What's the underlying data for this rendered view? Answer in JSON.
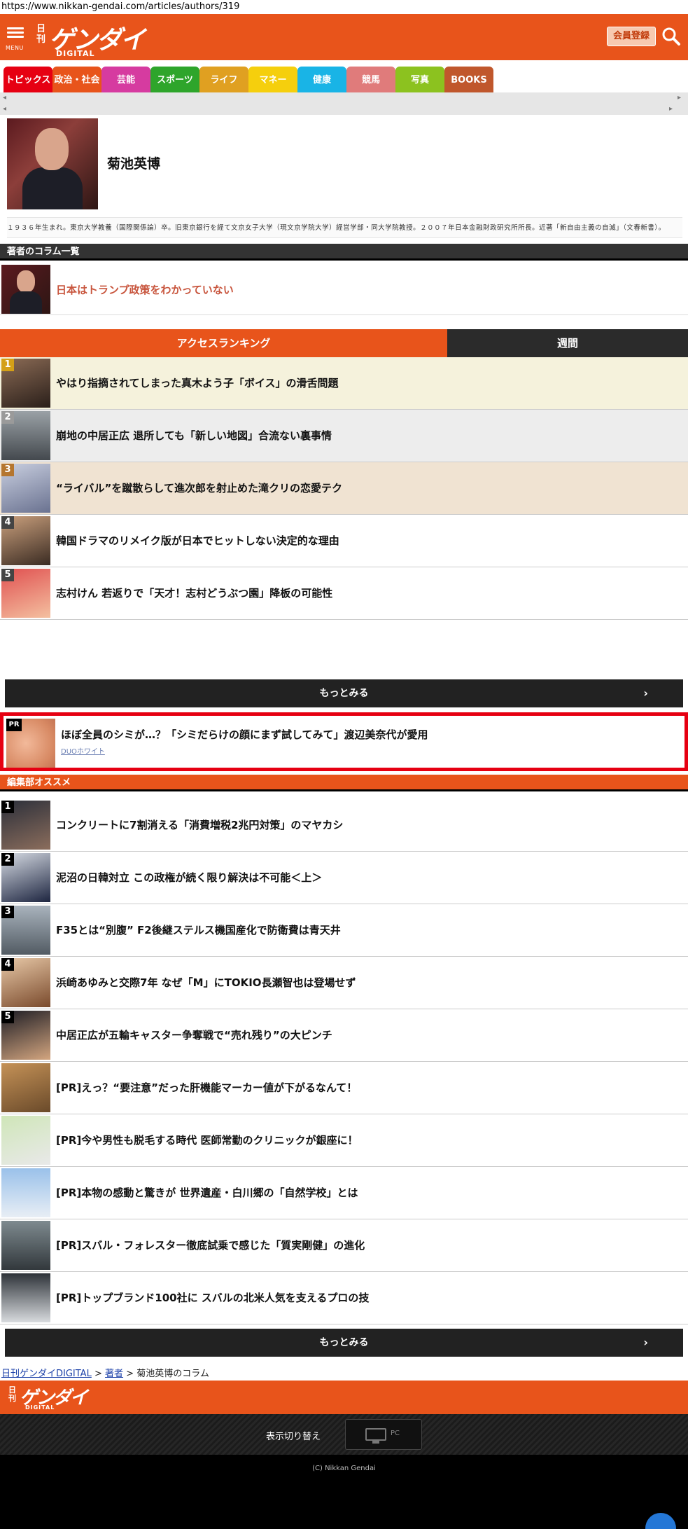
{
  "browser": {
    "url": "https://www.nikkan-gendai.com/articles/authors/319"
  },
  "header": {
    "menu_label": "MENU",
    "logo_small": "日刊",
    "logo_big": "ゲンダイ",
    "logo_sub": "DIGITAL",
    "member_button": "会員登録",
    "search_icon": "search-icon"
  },
  "categories": [
    {
      "label": "トピックス",
      "color": "#e60012"
    },
    {
      "label": "政治・社会",
      "color": "#e8541b"
    },
    {
      "label": "芸能",
      "color": "#d63ba0"
    },
    {
      "label": "スポーツ",
      "color": "#2ea52b"
    },
    {
      "label": "ライフ",
      "color": "#e0a021"
    },
    {
      "label": "マネー",
      "color": "#f5cf0d"
    },
    {
      "label": "健康",
      "color": "#19b4e6"
    },
    {
      "label": "競馬",
      "color": "#e07b7b"
    },
    {
      "label": "写真",
      "color": "#8cc21f"
    },
    {
      "label": "BOOKS",
      "color": "#c0572c"
    }
  ],
  "author": {
    "name": "菊池英博",
    "bio": "１９３６年生まれ。東京大学教養（国際関係論）卒。旧東京銀行を経て文京女子大学（現文京学院大学）経営学部・同大学院教授。２００７年日本金融財政研究所所長。近著「新自由主義の自滅」（文春新書）。"
  },
  "column_section": {
    "heading": "著者のコラム一覧",
    "items": [
      {
        "title": "日本はトランプ政策をわかっていない"
      }
    ]
  },
  "ranking": {
    "tab_active": "アクセスランキング",
    "tab_week": "週間",
    "items": [
      {
        "rank": "1",
        "title": "やはり指摘されてしまった真木よう子「ボイス」の滑舌問題",
        "bg": "#f5f2dc",
        "badge": "#d4a017"
      },
      {
        "rank": "2",
        "title": "崩地の中居正広 退所しても「新しい地図」合流ない裏事情",
        "bg": "#ededed",
        "badge": "#9a9a9a"
      },
      {
        "rank": "3",
        "title": "“ライバル”を蹴散らして進次郎を射止めた滝クリの恋愛テク",
        "bg": "#f0e3d2",
        "badge": "#b5762f"
      },
      {
        "rank": "4",
        "title": "韓国ドラマのリメイク版が日本でヒットしない決定的な理由",
        "bg": "#ffffff",
        "badge": "#444444"
      },
      {
        "rank": "5",
        "title": "志村けん 若返りで「天才！志村どうぶつ園」降板の可能性",
        "bg": "#ffffff",
        "badge": "#444444"
      }
    ],
    "more": "もっとみる"
  },
  "pr_ad": {
    "tag": "PR",
    "title": "ほぼ全員のシミが…？「シミだらけの顔にまず試してみて」渡辺美奈代が愛用",
    "sponsor": "DUOホワイト"
  },
  "recommend": {
    "heading": "編集部オススメ",
    "items": [
      {
        "rank": "1",
        "title": "コンクリートに7割消える「消費増税2兆円対策」のマヤカシ"
      },
      {
        "rank": "2",
        "title": "泥沼の日韓対立 この政権が続く限り解決は不可能＜上＞"
      },
      {
        "rank": "3",
        "title": "F35とは“別腹” F2後継ステルス機国産化で防衛費は青天井"
      },
      {
        "rank": "4",
        "title": "浜崎あゆみと交際7年 なぜ「M」にTOKIO長瀬智也は登場せず"
      },
      {
        "rank": "5",
        "title": "中居正広が五輪キャスター争奪戦で“売れ残り”の大ピンチ"
      },
      {
        "rank": "",
        "title": "[PR]えっ？“要注意”だった肝機能マーカー値が下がるなんて！"
      },
      {
        "rank": "",
        "title": "[PR]今や男性も脱毛する時代 医師常勤のクリニックが銀座に！"
      },
      {
        "rank": "",
        "title": "[PR]本物の感動と驚きが 世界遺産・白川郷の「自然学校」とは"
      },
      {
        "rank": "",
        "title": "[PR]スバル・フォレスター徹底試乗で感じた「質実剛健」の進化"
      },
      {
        "rank": "",
        "title": "[PR]トップブランド100社に スバルの北米人気を支えるプロの技"
      }
    ],
    "more": "もっとみる"
  },
  "breadcrumb": {
    "home": "日刊ゲンダイDIGITAL",
    "sep1": ">",
    "authors": "著者",
    "sep2": ">",
    "current": "菊池英博のコラム"
  },
  "footer": {
    "logo_small": "日刊",
    "logo_big": "ゲンダイ",
    "logo_sub": "DIGITAL",
    "switch_label": "表示切り替え",
    "pc_label": "PC",
    "copyright": "(C) Nikkan Gendai"
  }
}
